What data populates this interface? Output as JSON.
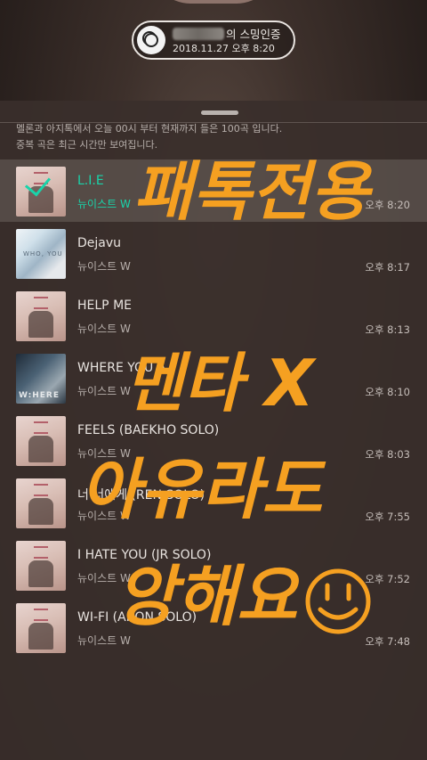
{
  "header": {
    "title_suffix": "의 스밍인증",
    "date_time": "2018.11.27 오후 8:20"
  },
  "notice": {
    "line1": "멜론과 아지톡에서 오늘 00시 부터 현재까지 들은 100곡 입니다.",
    "line2": "중복 곡은 최근 시간만 보여집니다."
  },
  "tracks": [
    {
      "title": "L.I.E",
      "artist": "뉴이스트 W",
      "time": "오후 8:20",
      "active": true
    },
    {
      "title": "Dejavu",
      "artist": "뉴이스트 W",
      "time": "오후 8:17"
    },
    {
      "title": "HELP ME",
      "artist": "뉴이스트 W",
      "time": "오후 8:13"
    },
    {
      "title": "WHERE YOU A",
      "artist": "뉴이스트 W",
      "time": "오후 8:10"
    },
    {
      "title": "FEELS (BAEKHO SOLO)",
      "artist": "뉴이스트 W",
      "time": "오후 8:03"
    },
    {
      "title": "너 너에게 (REN SOLO)",
      "artist": "뉴이스트 W",
      "time": "오후 7:55"
    },
    {
      "title": "I HATE YOU (JR SOLO)",
      "artist": "뉴이스트 W",
      "time": "오후 7:52"
    },
    {
      "title": "WI-FI (ARON SOLO)",
      "artist": "뉴이스트 W",
      "time": "오후 7:48"
    }
  ],
  "covers": {
    "dejavu_text": "WHO, YOU",
    "where_text": "W:HERE"
  },
  "handwriting": {
    "line1": "패톡전용",
    "line2": "멘타 X",
    "line3": "아유라도",
    "line4": "앙해요",
    "color": "#f5a021"
  },
  "colors": {
    "accent": "#19d4aa"
  }
}
